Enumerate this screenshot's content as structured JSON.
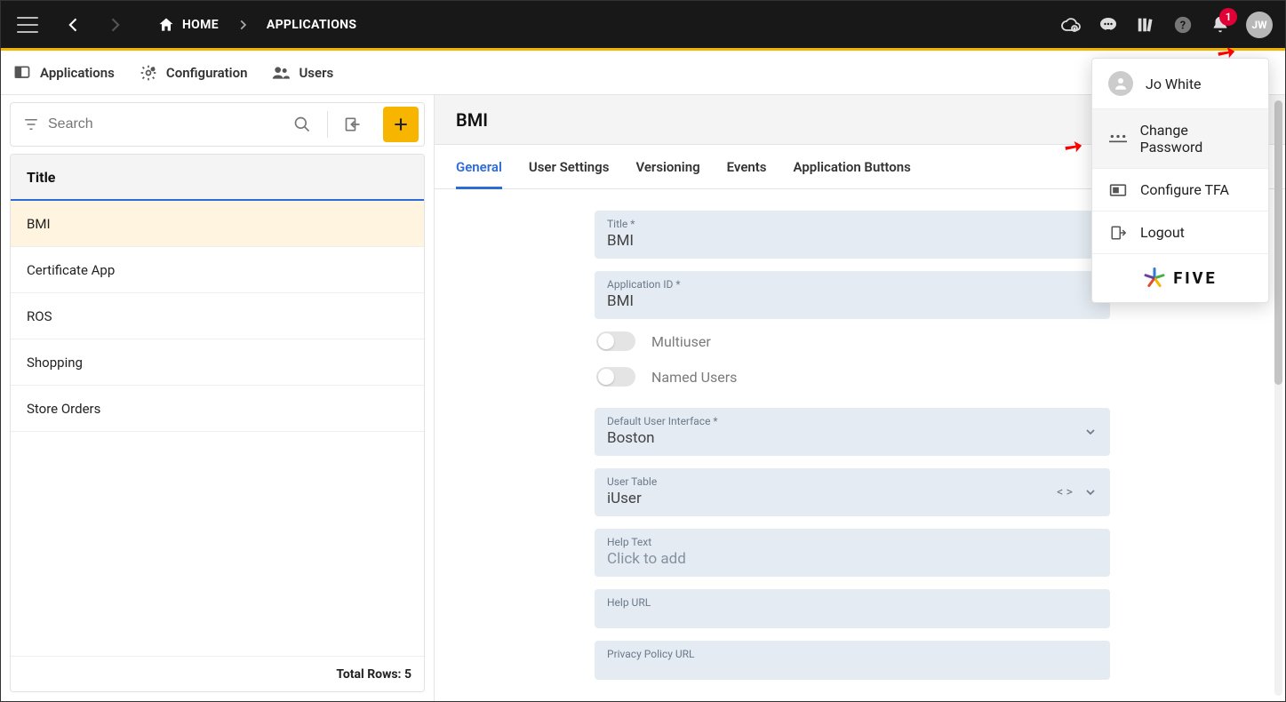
{
  "topbar": {
    "home_label": "HOME",
    "crumb_label": "APPLICATIONS",
    "badge_count": "1",
    "avatar_initials": "JW"
  },
  "secnav": {
    "items": [
      {
        "label": "Applications"
      },
      {
        "label": "Configuration"
      },
      {
        "label": "Users"
      }
    ]
  },
  "search": {
    "placeholder": "Search"
  },
  "list": {
    "header": "Title",
    "rows": [
      "BMI",
      "Certificate App",
      "ROS",
      "Shopping",
      "Store Orders"
    ],
    "footer": "Total Rows: 5"
  },
  "detail": {
    "title": "BMI",
    "tabs": [
      "General",
      "User Settings",
      "Versioning",
      "Events",
      "Application Buttons"
    ],
    "fields": {
      "title_label": "Title *",
      "title_value": "BMI",
      "appid_label": "Application ID *",
      "appid_value": "BMI",
      "multiuser_label": "Multiuser",
      "namedusers_label": "Named Users",
      "defui_label": "Default User Interface *",
      "defui_value": "Boston",
      "usertable_label": "User Table",
      "usertable_value": "iUser",
      "helptext_label": "Help Text",
      "helptext_value": "Click to add",
      "helpurl_label": "Help URL",
      "privacy_label": "Privacy Policy URL"
    }
  },
  "usermenu": {
    "username": "Jo White",
    "change_password": "Change Password",
    "configure_tfa": "Configure TFA",
    "logout": "Logout",
    "brand": "FIVE"
  }
}
